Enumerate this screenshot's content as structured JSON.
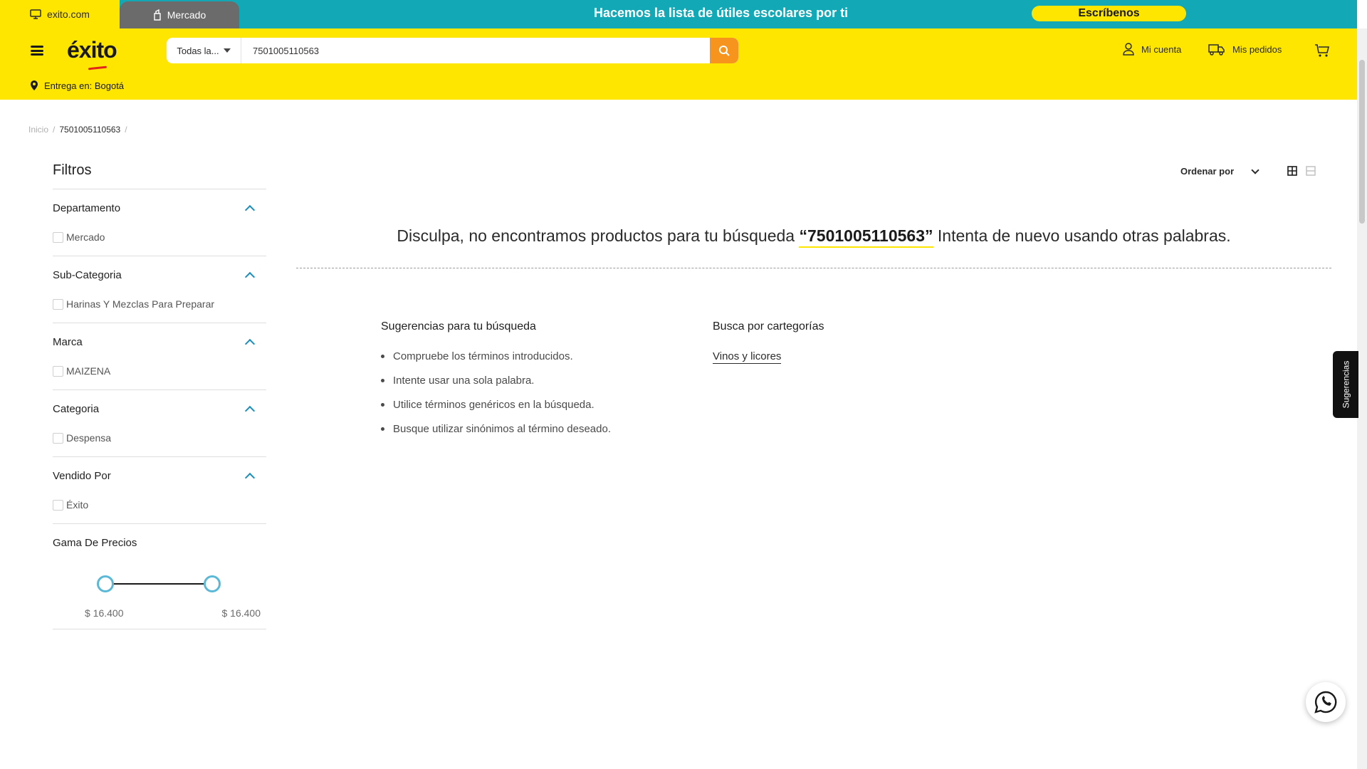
{
  "top_strip": {
    "tab_exito": "exito.com",
    "tab_mercado": "Mercado",
    "promo_text": "Hacemos la lista de útiles escolares por ti",
    "promo_button": "Escríbenos",
    "color": "#13a8b6"
  },
  "header": {
    "logo": "éxito",
    "search": {
      "category": "Todas la...",
      "value": "7501005110563"
    },
    "account_label": "Mi cuenta",
    "orders_label": "Mis pedidos",
    "delivery_label": "Entrega en: Bogotá",
    "color": "#ffe600",
    "accent": "#f7941d"
  },
  "breadcrumb": {
    "home": "Inicio",
    "sep": "/",
    "current": "7501005110563",
    "trail_sep": "/"
  },
  "filters": {
    "title": "Filtros",
    "groups": [
      {
        "label": "Departamento",
        "option": "Mercado"
      },
      {
        "label": "Sub-Categoria",
        "option": "Harinas Y Mezclas Para Preparar"
      },
      {
        "label": "Marca",
        "option": "MAIZENA"
      },
      {
        "label": "Categoria",
        "option": "Despensa"
      },
      {
        "label": "Vendido Por",
        "option": "Éxito"
      }
    ],
    "price": {
      "label": "Gama De Precios",
      "min": "$ 16.400",
      "max": "$ 16.400"
    }
  },
  "sort": {
    "label": "Ordenar por"
  },
  "results": {
    "msg_before": "Disculpa, no encontramos productos para tu búsqueda ",
    "term": "“7501005110563”",
    "msg_after": " Intenta de nuevo usando otras palabras."
  },
  "suggestions": {
    "title": "Sugerencias para tu búsqueda",
    "items": [
      "Compruebe los términos introducidos.",
      "Intente usar una sola palabra.",
      "Utilice términos genéricos en la búsqueda.",
      "Busque utilizar sinónimos al término deseado."
    ]
  },
  "categories": {
    "title": "Busca por cartegorías",
    "link": "Vinos y licores"
  },
  "side_tab": "Sugerencias",
  "icons": [
    "monitor-icon",
    "bag-icon",
    "menu-icon",
    "search-icon",
    "user-icon",
    "truck-icon",
    "cart-icon",
    "location-pin-icon",
    "grid-view-icon",
    "list-view-icon",
    "whatsapp-icon"
  ]
}
